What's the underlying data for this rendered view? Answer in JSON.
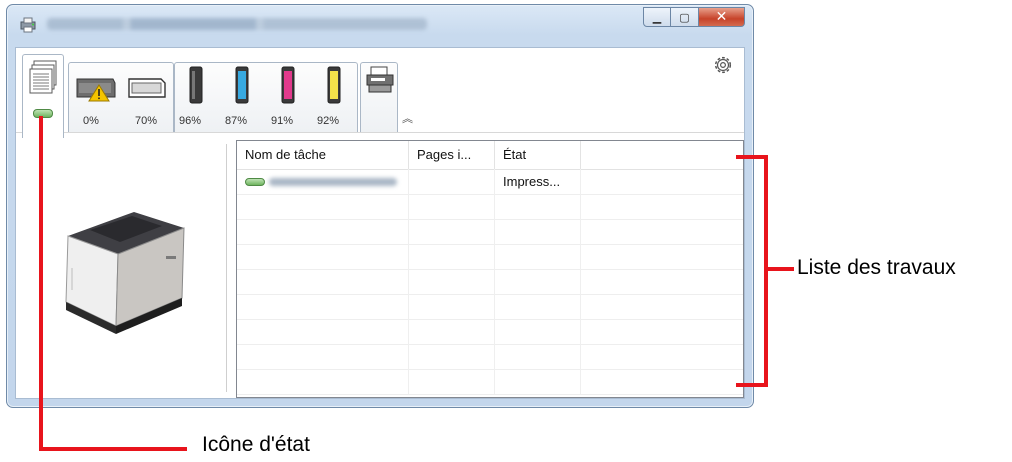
{
  "window": {
    "caption_buttons": {
      "minimize": "▁",
      "maximize": "▢",
      "close": "✕"
    }
  },
  "toolbar": {
    "tabs": [
      {
        "name": "status",
        "label": ""
      },
      {
        "name": "paper",
        "levels": [
          "0%",
          "70%"
        ]
      },
      {
        "name": "toner",
        "levels": [
          "96%",
          "87%",
          "91%",
          "92%"
        ]
      },
      {
        "name": "scanner",
        "label": ""
      }
    ],
    "collapse_glyph": "︽",
    "settings_icon": "gear-icon"
  },
  "job_list": {
    "columns": [
      "Nom de tâche",
      "Pages i...",
      "État"
    ],
    "rows": [
      {
        "state": "Impress..."
      }
    ]
  },
  "colors": {
    "toner_black": "#3a3a3a",
    "toner_cyan": "#37a9e0",
    "toner_magenta": "#e23a8c",
    "toner_yellow": "#f3e24a",
    "annotation": "#e8141c",
    "status_led": "#6fb45f"
  },
  "annotations": {
    "job_list_label": "Liste des travaux",
    "status_icon_label": "Icône d'état"
  }
}
